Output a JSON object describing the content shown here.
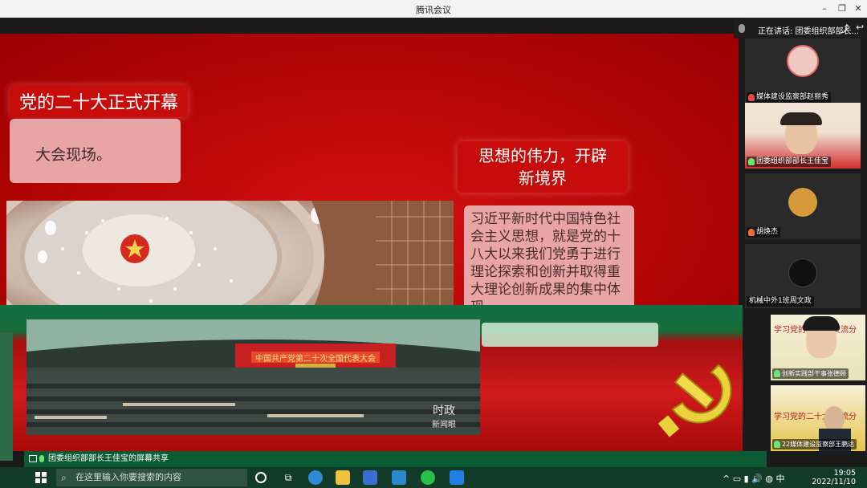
{
  "window": {
    "title": "腾讯会议"
  },
  "speaker": {
    "text": "正在讲话: 团委组织部部长..."
  },
  "slide": {
    "heading": "党的二十大正式开幕",
    "venue_caption": "大会现场。",
    "subheading_line1": "思想的伟力，开辟",
    "subheading_line2": "新境界",
    "body_text": "习近平新时代中国特色社会主义思想，就是党的十八大以来我们党勇于进行理论探索和创新并取得重大理论创新成果的集中体现。",
    "hall_banner": "中国共产党第二十次全国代表大会",
    "news_badge_line1": "时政",
    "news_badge_line2": "新闻眼"
  },
  "participants": [
    {
      "name": "媒体建设监察部赵丽秀",
      "mic": "off"
    },
    {
      "name": "团委组织部部长王佳宝",
      "mic": "on"
    },
    {
      "name": "胡焕杰",
      "mic": "off"
    },
    {
      "name": "机械中外1班周文政",
      "mic": "none"
    }
  ],
  "side_tiles": [
    {
      "name": "创新实践部干事张德颐",
      "bg_text": "学习党的二十大 交流分"
    },
    {
      "name": "22媒体建设监察部王鹏达",
      "bg_text": "学习党的二十大 交流分"
    }
  ],
  "share_status": "团委组织部部长王佳宝的屏幕共享",
  "taskbar": {
    "search_placeholder": "在这里输入你要搜索的内容",
    "time": "19:05",
    "date": "2022/11/10"
  },
  "colors": {
    "slide_red": "#c70c0c",
    "card_pink": "#e9a5a5",
    "taskbar": "#123b2a"
  }
}
